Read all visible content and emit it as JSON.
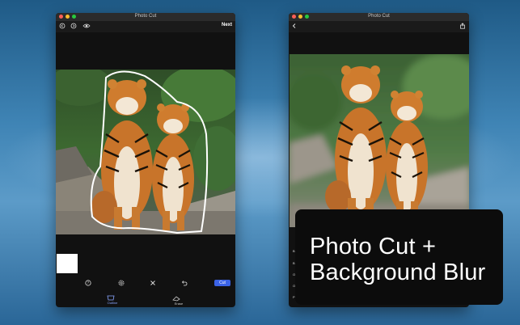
{
  "left_window": {
    "title": "Photo Cut",
    "toolbar": {
      "next_label": "Next",
      "icons": [
        "back-circle-icon",
        "forward-circle-icon",
        "eye-icon"
      ]
    },
    "bottom_icons": [
      "help-icon",
      "settings-icon",
      "close-icon",
      "undo-icon"
    ],
    "cut_label": "Cut",
    "tabs": [
      {
        "label": "Outline",
        "active": true
      },
      {
        "label": "Erase",
        "active": false
      }
    ]
  },
  "right_window": {
    "title": "Photo Cut",
    "toolbar": {
      "icons": [
        "back-chevron-icon",
        "share-icon"
      ]
    },
    "side_letters": [
      "B",
      "B",
      "O",
      "O",
      "P"
    ]
  },
  "caption": {
    "line1": "Photo Cut +",
    "line2": "Background Blur"
  },
  "colors": {
    "accent": "#3b63e6",
    "window_bg": "#111111",
    "caption_bg": "#0c0c0c"
  }
}
